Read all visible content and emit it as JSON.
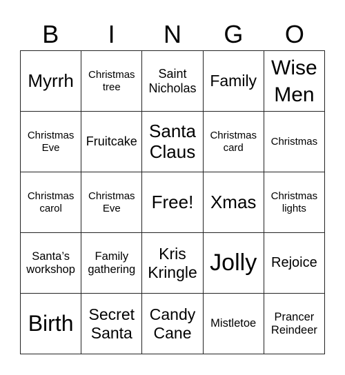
{
  "header": {
    "letters": [
      "B",
      "I",
      "N",
      "G",
      "O"
    ]
  },
  "grid": {
    "rows": [
      [
        "Myrrh",
        "Christmas tree",
        "Saint Nicholas",
        "Family",
        "Wise Men"
      ],
      [
        "Christmas Eve",
        "Fruitcake",
        "Santa Claus",
        "Christmas card",
        "Christmas"
      ],
      [
        "Christmas carol",
        "Christmas Eve",
        "Free!",
        "Xmas",
        "Christmas lights"
      ],
      [
        "Santa’s workshop",
        "Family gathering",
        "Kris Kringle",
        "Jolly",
        "Rejoice"
      ],
      [
        "Birth",
        "Secret Santa",
        "Candy Cane",
        "Mistletoe",
        "Prancer Reindeer"
      ]
    ]
  }
}
